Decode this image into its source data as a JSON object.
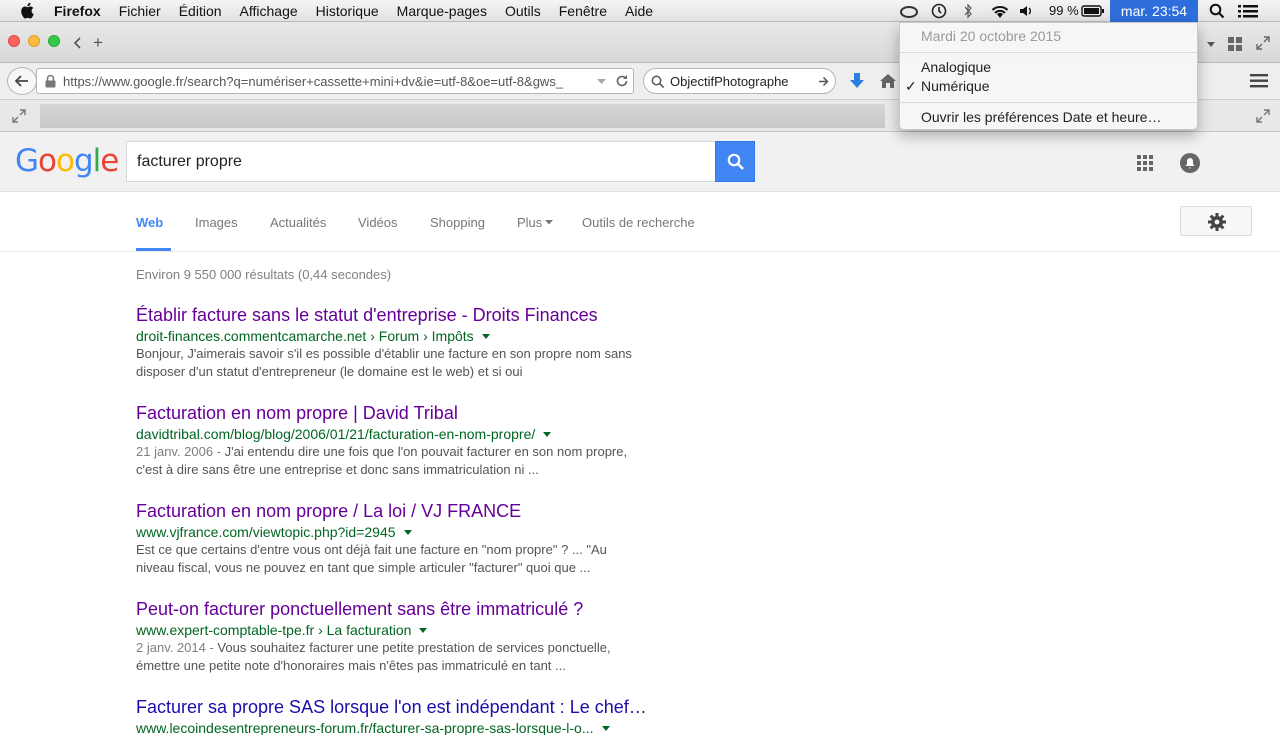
{
  "menubar": {
    "app": "Firefox",
    "items": [
      "Fichier",
      "Édition",
      "Affichage",
      "Historique",
      "Marque-pages",
      "Outils",
      "Fenêtre",
      "Aide"
    ],
    "battery": "99 %",
    "clock": "mar. 23:54"
  },
  "clock_menu": {
    "date": "Mardi 20 octobre 2015",
    "option_analog": "Analogique",
    "option_digital": "Numérique",
    "check": "✓",
    "prefs": "Ouvrir les préférences Date et heure…"
  },
  "browser": {
    "url": "https://www.google.fr/search?q=numériser+cassette+mini+dv&ie=utf-8&oe=utf-8&gws_",
    "search_engine_text": "ObjectifPhotographe",
    "new_tab": "+"
  },
  "google": {
    "query": "facturer propre",
    "tabs": [
      "Web",
      "Images",
      "Actualités",
      "Vidéos",
      "Shopping",
      "Plus",
      "Outils de recherche"
    ],
    "stats": "Environ 9 550 000 résultats (0,44 secondes)",
    "results": [
      {
        "title": "Établir facture sans le statut d'entreprise - Droits Finances",
        "cite": "droit-finances.commentcamarche.net › Forum › Impôts",
        "date": "",
        "snippet_line1": "Bonjour, J'aimerais savoir s'il es possible d'établir une facture en son propre nom sans",
        "snippet_line2": "disposer d'un statut d'entrepreneur (le domaine est le web) et si oui"
      },
      {
        "title": "Facturation en nom propre | David Tribal",
        "cite": "davidtribal.com/blog/blog/2006/01/21/facturation-en-nom-propre/",
        "date": "21 janv. 2006 - ",
        "snippet_line1": "J'ai entendu dire une fois que l'on pouvait facturer en son nom propre,",
        "snippet_line2": "c'est à dire sans être une entreprise et donc sans immatriculation ni ..."
      },
      {
        "title": "Facturation en nom propre / La loi / VJ FRANCE",
        "cite": "www.vjfrance.com/viewtopic.php?id=2945",
        "date": "",
        "snippet_line1": "Est ce que certains d'entre vous ont déjà fait une facture en \"nom propre\" ? ... \"Au",
        "snippet_line2": "niveau fiscal, vous ne pouvez en tant que simple articuler \"facturer\" quoi que ..."
      },
      {
        "title": "Peut-on facturer ponctuellement sans être immatriculé ?",
        "cite": "www.expert-comptable-tpe.fr › La facturation",
        "date": "2 janv. 2014 - ",
        "snippet_line1": "Vous souhaitez facturer une petite prestation de services ponctuelle,",
        "snippet_line2": "émettre une petite note d'honoraires mais n'êtes pas immatriculé en tant ..."
      },
      {
        "title": "Facturer sa propre SAS lorsque l'on est indépendant : Le chef…",
        "cite": "www.lecoindesentrepreneurs-forum.fr/facturer-sa-propre-sas-lorsque-l-o...",
        "date": "",
        "snippet_line1": "",
        "snippet_line2": ""
      }
    ]
  },
  "colors": {
    "visited_link": "#660099",
    "link": "#1a0dab",
    "url_green": "#006621",
    "google_blue": "#4285f4",
    "menubar_highlight": "#2e6edb"
  }
}
